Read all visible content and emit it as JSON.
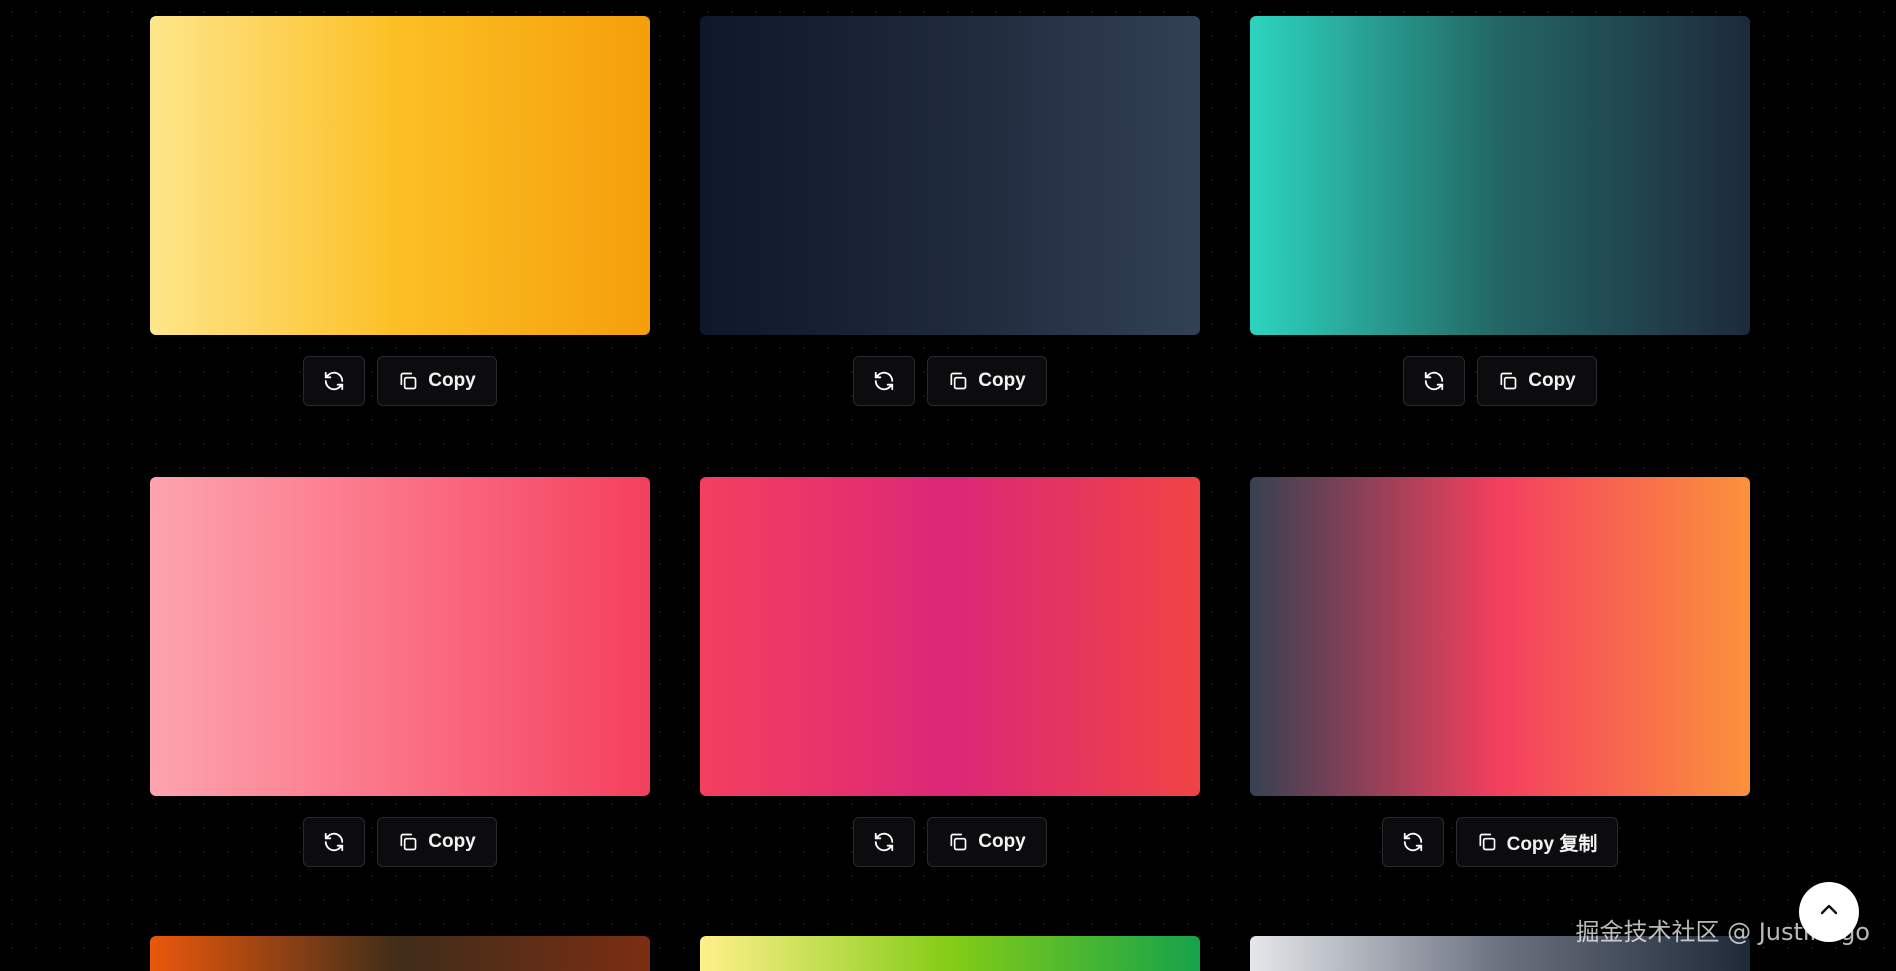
{
  "cards": [
    {
      "gradient": [
        "#fde68a",
        "#fbbf24",
        "#f59e0b"
      ],
      "copy_label": "Copy"
    },
    {
      "gradient": [
        "#0f172a",
        "#1e293b",
        "#334155"
      ],
      "copy_label": "Copy"
    },
    {
      "gradient": [
        "#2dd4bf",
        "#236663",
        "#1e293b"
      ],
      "copy_label": "Copy"
    },
    {
      "gradient": [
        "#fda4af",
        "#fb7185",
        "#f43f5e"
      ],
      "copy_label": "Copy"
    },
    {
      "gradient": [
        "#f43f5e",
        "#db2777",
        "#ef4444"
      ],
      "copy_label": "Copy"
    },
    {
      "gradient": [
        "#374151",
        "#f43f5e",
        "#fb923c"
      ],
      "copy_label": "Copy 复制"
    }
  ],
  "partial_cards": [
    {
      "gradient": [
        "#ea580c",
        "#3f2d1a",
        "#7c2d12"
      ]
    },
    {
      "gradient": [
        "#fef08a",
        "#84cc16",
        "#16a34a"
      ]
    },
    {
      "gradient": [
        "#e5e7eb",
        "#6b7280",
        "#1f2937"
      ]
    }
  ],
  "icons": {
    "refresh": "refresh-icon",
    "copy": "copy-icon",
    "scroll_top": "chevron-up-icon"
  },
  "watermark": "掘金技术社区 @ Justin3go"
}
